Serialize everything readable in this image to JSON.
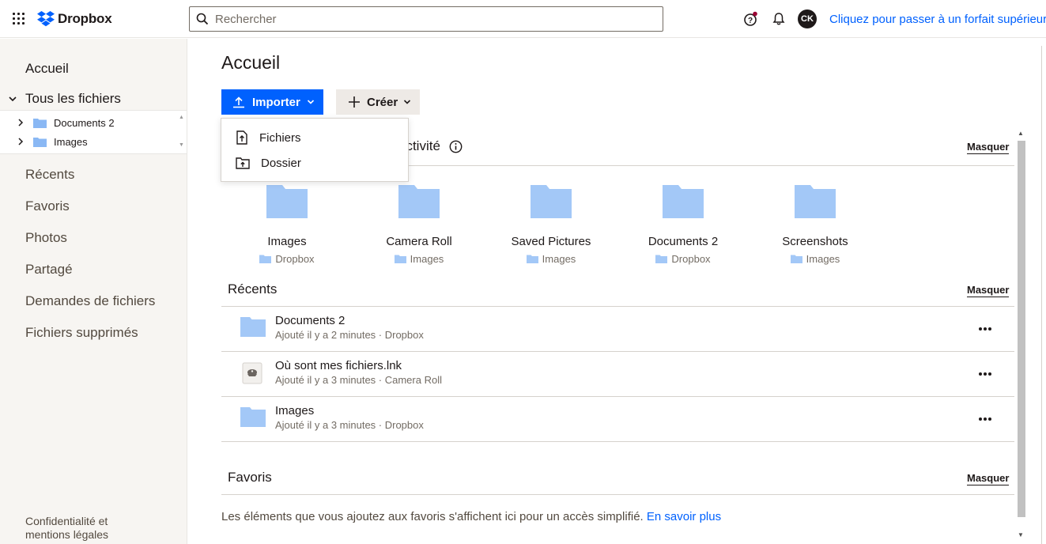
{
  "brand": {
    "name": "Dropbox"
  },
  "search": {
    "placeholder": "Rechercher"
  },
  "header": {
    "avatar_initials": "CK",
    "upgrade_link": "Cliquez pour passer à un forfait supérieur"
  },
  "sidebar": {
    "home": "Accueil",
    "all_files": "Tous les fichiers",
    "tree": [
      {
        "label": "Documents 2"
      },
      {
        "label": "Images"
      }
    ],
    "items": [
      "Récents",
      "Favoris",
      "Photos",
      "Partagé",
      "Demandes de fichiers",
      "Fichiers supprimés"
    ],
    "legal_line1": "Confidentialité et",
    "legal_line2": "mentions légales"
  },
  "main": {
    "title": "Accueil",
    "import_label": "Importer",
    "create_label": "Créer",
    "import_menu": [
      "Fichiers",
      "Dossier"
    ],
    "activity": {
      "title_visible": "activité",
      "hide": "Masquer",
      "tiles": [
        {
          "name": "Images",
          "location": "Dropbox"
        },
        {
          "name": "Camera Roll",
          "location": "Images"
        },
        {
          "name": "Saved Pictures",
          "location": "Images"
        },
        {
          "name": "Documents 2",
          "location": "Dropbox"
        },
        {
          "name": "Screenshots",
          "location": "Images"
        }
      ]
    },
    "recents": {
      "title": "Récents",
      "hide": "Masquer",
      "rows": [
        {
          "name": "Documents 2",
          "meta": "Ajouté il y a 2 minutes · Dropbox",
          "icon": "folder-icon"
        },
        {
          "name": "Où sont mes fichiers.lnk",
          "meta": "Ajouté il y a 3 minutes · Camera Roll",
          "icon": "shortcut-file-icon"
        },
        {
          "name": "Images",
          "meta": "Ajouté il y a 3 minutes · Dropbox",
          "icon": "folder-icon"
        }
      ]
    },
    "favorites": {
      "title": "Favoris",
      "hide": "Masquer",
      "empty_text": "Les éléments que vous ajoutez aux favoris s'affichent ici pour un accès simplifié.",
      "learn_more": "En savoir plus"
    }
  },
  "colors": {
    "accent": "#0061fe",
    "folder": "#a3c8f7",
    "sidebar_bg": "#f7f5f2",
    "create_bg": "#eeeae6"
  }
}
